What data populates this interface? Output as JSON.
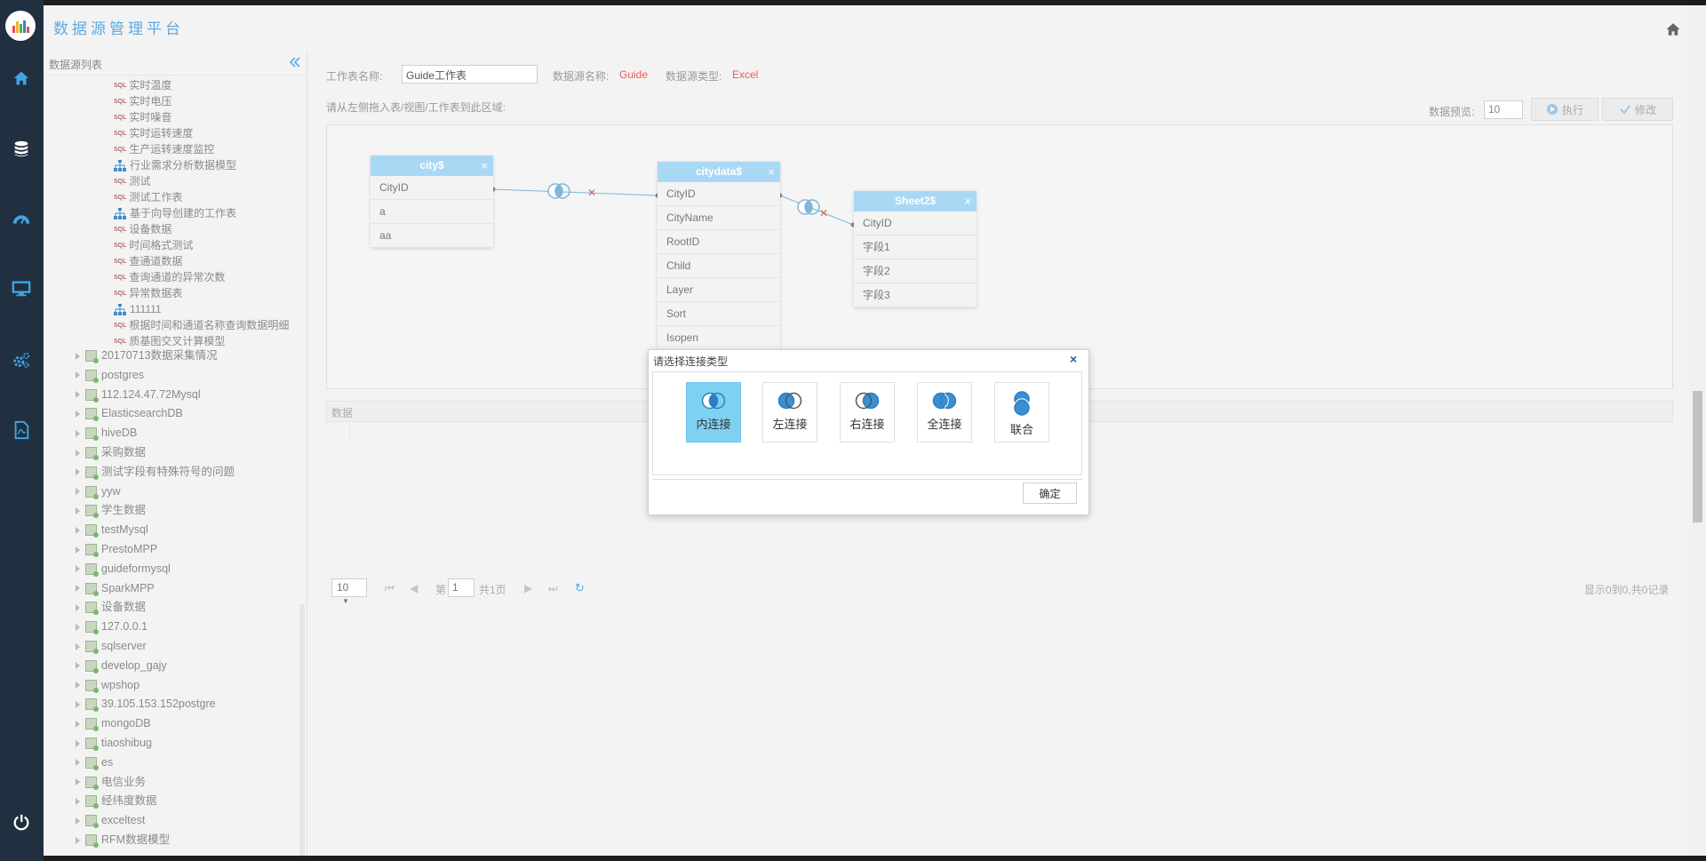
{
  "header": {
    "title": "数据源管理平台"
  },
  "sidebar": {
    "title": "数据源列表",
    "sql_badge": "SQL",
    "items": [
      {
        "label": "实时温度",
        "kind": "sql"
      },
      {
        "label": "实时电压",
        "kind": "sql"
      },
      {
        "label": "实时噪音",
        "kind": "sql"
      },
      {
        "label": "实时运转速度",
        "kind": "sql"
      },
      {
        "label": "生产运转速度监控",
        "kind": "sql"
      },
      {
        "label": "行业需求分析数据模型",
        "kind": "model"
      },
      {
        "label": "测试",
        "kind": "sql"
      },
      {
        "label": "测试工作表",
        "kind": "sql"
      },
      {
        "label": "基于向导创建的工作表",
        "kind": "model"
      },
      {
        "label": "设备数据",
        "kind": "sql"
      },
      {
        "label": "时间格式测试",
        "kind": "sql"
      },
      {
        "label": "查通道数据",
        "kind": "sql"
      },
      {
        "label": "查询通道的异常次数",
        "kind": "sql"
      },
      {
        "label": "异常数据表",
        "kind": "sql"
      },
      {
        "label": "111111",
        "kind": "model"
      },
      {
        "label": "根据时间和通道名称查询数据明细",
        "kind": "sql"
      },
      {
        "label": "质基图交叉计算模型",
        "kind": "sql"
      }
    ],
    "datasources": [
      "20170713数据采集情况",
      "postgres",
      "112.124.47.72Mysql",
      "ElasticsearchDB",
      "hiveDB",
      "采购数据",
      "测试字段有特殊符号的问题",
      "yyw",
      "学生数据",
      "testMysql",
      "PrestoMPP",
      "guideformysql",
      "SparkMPP",
      "设备数据",
      "127.0.0.1",
      "sqlserver",
      "develop_gajy",
      "wpshop",
      "39.105.153.152postgre",
      "mongoDB",
      "tiaoshibug",
      "es",
      "电信业务",
      "经纬度数据",
      "exceltest",
      "RFM数据模型"
    ]
  },
  "form": {
    "worksheet_label": "工作表名称:",
    "worksheet_value": "Guide工作表",
    "source_label": "数据源名称:",
    "source_value": "Guide",
    "type_label": "数据源类型:",
    "type_value": "Excel",
    "hint": "请从左侧拖入表/视图/工作表到此区域:",
    "preview_label": "数据预览:",
    "preview_value": "10",
    "run_label": "执行",
    "edit_label": "修改"
  },
  "tables": [
    {
      "name": "city$",
      "fields": [
        "CityID",
        "a",
        "aa"
      ]
    },
    {
      "name": "citydata$",
      "fields": [
        "CityID",
        "CityName",
        "RootID",
        "Child",
        "Layer",
        "Sort",
        "Isopen"
      ]
    },
    {
      "name": "Sheet2$",
      "fields": [
        "CityID",
        "字段1",
        "字段2",
        "字段3"
      ]
    }
  ],
  "table_close": "×",
  "data_section": {
    "label": "数据"
  },
  "pager": {
    "page_size": "10",
    "page_prefix": "第",
    "page_value": "1",
    "page_total": "共1页",
    "record_info": "显示0到0,共0记录"
  },
  "dialog": {
    "title": "请选择连接类型",
    "close": "×",
    "options": [
      {
        "label": "内连接",
        "selected": true
      },
      {
        "label": "左连接",
        "selected": false
      },
      {
        "label": "右连接",
        "selected": false
      },
      {
        "label": "全连接",
        "selected": false
      },
      {
        "label": "联合",
        "selected": false
      }
    ],
    "ok_label": "确定"
  },
  "colors": {
    "accent": "#5fa9e0",
    "rail": "#213040",
    "table_header": "#a9d8f5",
    "selected_join": "#7fd1f2",
    "value_red": "#e85a5a"
  }
}
